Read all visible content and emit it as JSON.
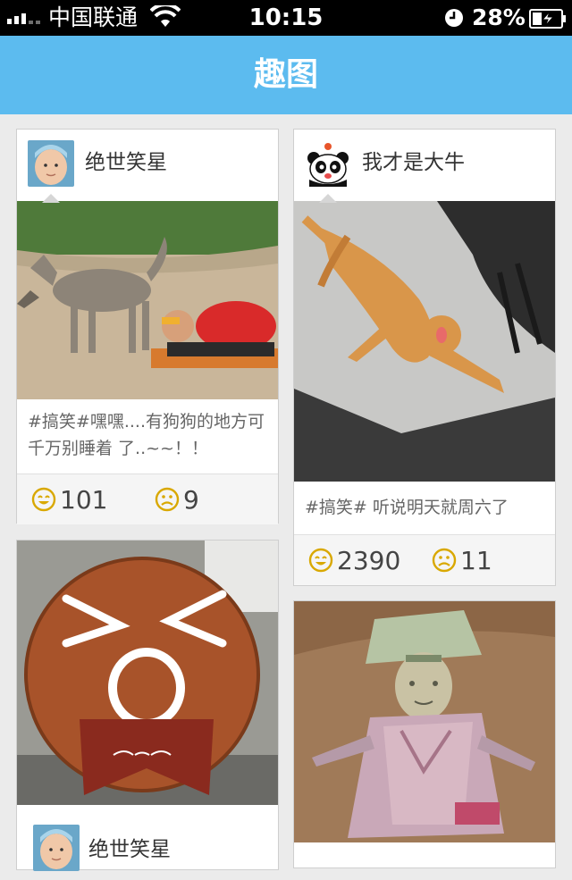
{
  "status_bar": {
    "carrier": "中国联通",
    "time": "10:15",
    "battery": "28%",
    "signal_bars": 3
  },
  "nav": {
    "title": "趣图"
  },
  "colors": {
    "accent": "#5cbbef",
    "smile": "#d9a800"
  },
  "icons": {
    "happy": "smile-icon",
    "sad": "frown-icon",
    "wifi": "wifi-icon",
    "clock": "alarm-clock-icon",
    "battery": "battery-charging-icon"
  },
  "cards": [
    {
      "user": "绝世笑星",
      "caption": "#搞笑#嘿嘿....有狗狗的地方可千万别睡着 了..~~！！",
      "likes": "101",
      "dislikes": "9"
    },
    {
      "user": "我才是大牛",
      "caption": "#搞笑# 听说明天就周六了",
      "likes": "2390",
      "dislikes": "11"
    },
    {
      "user": "绝世笑星"
    },
    {
      "user": ""
    }
  ]
}
